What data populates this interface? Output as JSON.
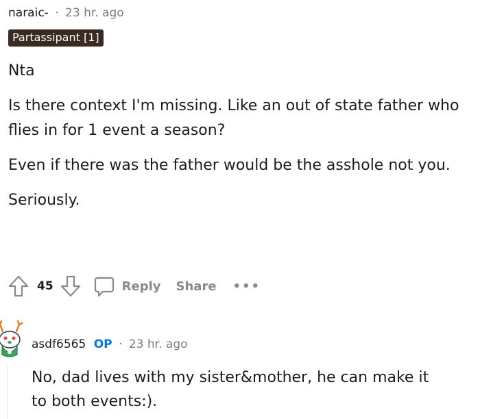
{
  "comment": {
    "author": "naraic-",
    "separator": "·",
    "time": "23 hr. ago",
    "flair": "Partassipant [1]",
    "paragraphs": [
      "Nta",
      "Is there context I'm missing. Like an out of state father who flies in for 1 event a season?",
      "Even if there was the father would be the asshole not you.",
      "Seriously."
    ],
    "score": "45",
    "reply_label": "Reply",
    "share_label": "Share",
    "more_label": "•••"
  },
  "reply": {
    "author": "asdf6565",
    "op_badge": "OP",
    "separator": "·",
    "time": "23 hr. ago",
    "body": "No, dad lives with my sister&mother, he can make it to both events:)."
  },
  "colors": {
    "meta_gray": "#7c7c7c",
    "action_gray": "#878a8c",
    "flair_bg": "#3a2a22",
    "op_blue": "#0079d3"
  },
  "icons": [
    "upvote-icon",
    "downvote-icon",
    "comment-bubble-icon",
    "more-options-icon",
    "snoo-avatar-icon"
  ]
}
